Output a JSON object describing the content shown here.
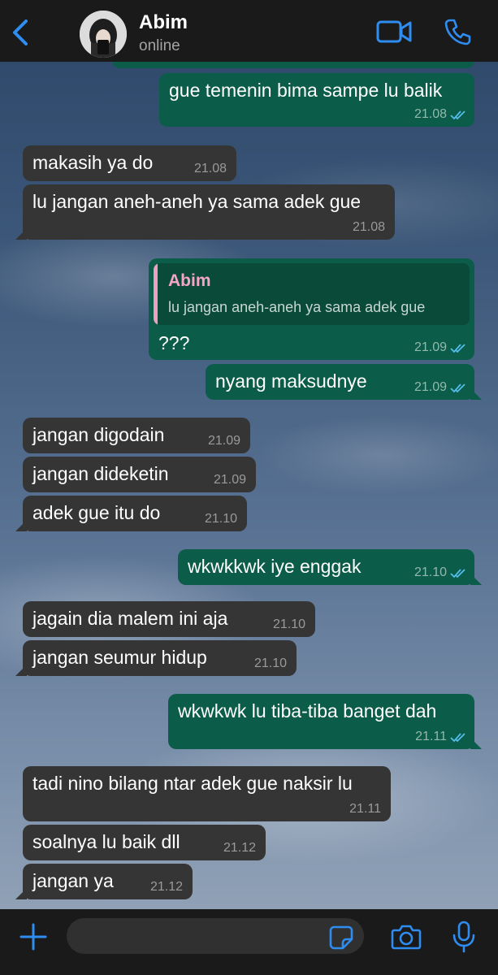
{
  "header": {
    "contact_name": "Abim",
    "status": "online"
  },
  "messages": [
    {
      "text": "gue temenin bima sampe lu balik",
      "time": "21.08",
      "dir": "out"
    },
    {
      "text": "makasih ya do",
      "time": "21.08",
      "dir": "in"
    },
    {
      "text": "lu jangan aneh-aneh ya sama adek gue",
      "time": "21.08",
      "dir": "in"
    },
    {
      "text": "???",
      "time": "21.09",
      "dir": "out",
      "quote": {
        "name": "Abim",
        "text": "lu jangan aneh-aneh ya sama adek gue"
      }
    },
    {
      "text": "nyang maksudnye",
      "time": "21.09",
      "dir": "out"
    },
    {
      "text": "jangan digodain",
      "time": "21.09",
      "dir": "in"
    },
    {
      "text": "jangan dideketin",
      "time": "21.09",
      "dir": "in"
    },
    {
      "text": "adek gue itu do",
      "time": "21.10",
      "dir": "in"
    },
    {
      "text": "wkwkkwk iye enggak",
      "time": "21.10",
      "dir": "out"
    },
    {
      "text": "jagain dia malem ini aja",
      "time": "21.10",
      "dir": "in"
    },
    {
      "text": "jangan seumur hidup",
      "time": "21.10",
      "dir": "in"
    },
    {
      "text": "wkwkwk lu tiba-tiba banget dah",
      "time": "21.11",
      "dir": "out"
    },
    {
      "text": "tadi nino bilang ntar adek gue naksir lu",
      "time": "21.11",
      "dir": "in"
    },
    {
      "text": "soalnya lu baik dll",
      "time": "21.12",
      "dir": "in"
    },
    {
      "text": "jangan ya",
      "time": "21.12",
      "dir": "in"
    }
  ],
  "composer": {
    "value": "",
    "placeholder": ""
  },
  "icons": {
    "back": "chevron-left-icon",
    "video": "video-camera-icon",
    "call": "phone-icon",
    "attach": "plus-icon",
    "sticker": "sticker-icon",
    "camera": "camera-icon",
    "mic": "microphone-icon"
  },
  "colors": {
    "accent": "#2f8cf0",
    "outgoing_bubble": "#0b5c48",
    "incoming_bubble": "#353535",
    "read_tick": "#53bdeb",
    "quote_name": "#f3a6c6"
  }
}
